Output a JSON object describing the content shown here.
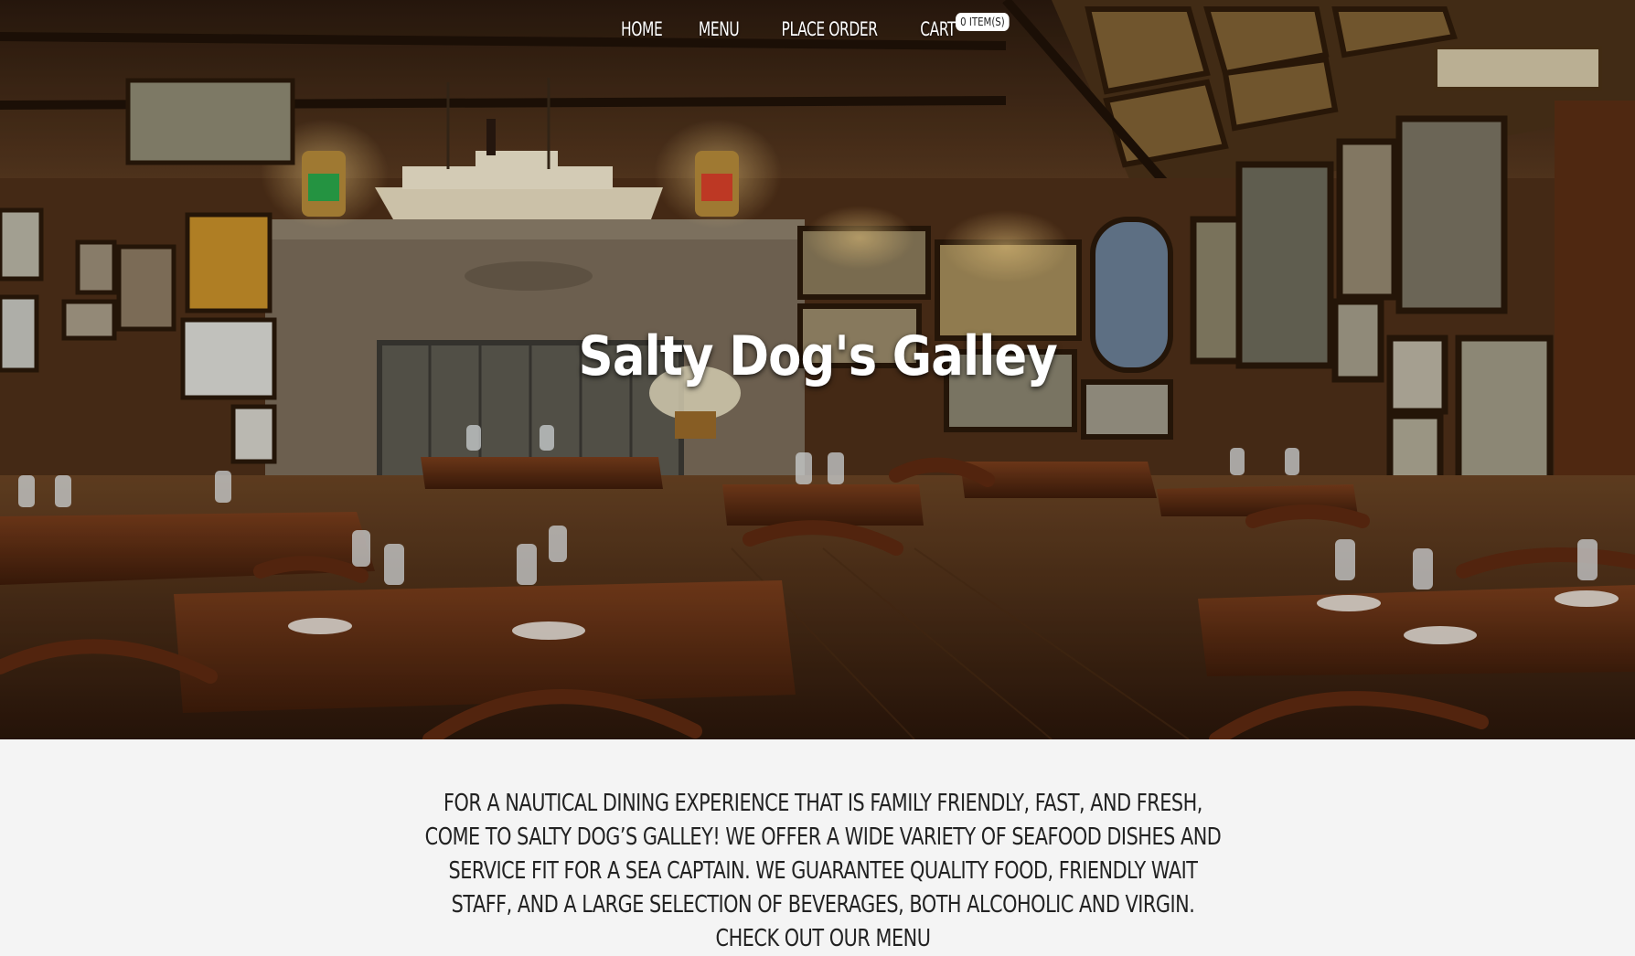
{
  "nav": {
    "items": [
      {
        "label": "HOME"
      },
      {
        "label": "MENU"
      },
      {
        "label": "PLACE ORDER"
      },
      {
        "label": "CART"
      }
    ],
    "cart_badge": "0 ITEM(S)"
  },
  "hero": {
    "title": "Salty Dog's Galley",
    "background_description_colors": {
      "wood_dark": "#2a170b",
      "wood_mid": "#6b4628",
      "lamp_glow": "#ffbe6e"
    }
  },
  "intro": {
    "text": "FOR A NAUTICAL DINING EXPERIENCE THAT IS FAMILY FRIENDLY, FAST, AND FRESH, COME TO SALTY DOG’S GALLEY! WE OFFER A WIDE VARIETY OF SEAFOOD DISHES AND SERVICE FIT FOR A SEA CAPTAIN. WE GUARANTEE QUALITY FOOD, FRIENDLY WAIT STAFF, AND A LARGE SELECTION OF BEVERAGES, BOTH ALCOHOLIC AND VIRGIN. CHECK OUT OUR MENU"
  }
}
